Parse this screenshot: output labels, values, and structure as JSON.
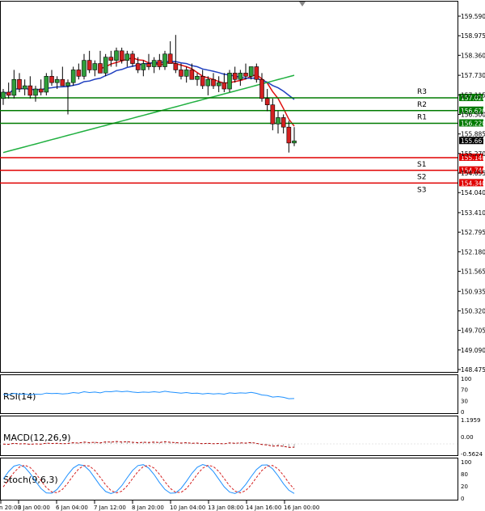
{
  "chart_data": {
    "type": "candlestick",
    "title": "",
    "price_axis": {
      "ticks": [
        "159.590",
        "158.975",
        "158.360",
        "157.730",
        "157.115",
        "156.500",
        "155.885",
        "155.270",
        "154.655",
        "154.040",
        "153.410",
        "152.795",
        "152.180",
        "151.565",
        "150.935",
        "150.320",
        "149.705",
        "149.090",
        "148.475"
      ],
      "range": [
        148.475,
        159.9
      ]
    },
    "time_axis": {
      "ticks": [
        "2 Jan 20:00",
        "3 Jan 00:00",
        "6 Jan 04:00",
        "7 Jan 12:00",
        "8 Jan 20:00",
        "10 Jan 04:00",
        "13 Jan 08:00",
        "14 Jan 16:00",
        "16 Jan 00:00"
      ]
    },
    "current_price": "155.667",
    "levels": [
      {
        "label": "R3",
        "value": 157.02,
        "value_text": "157.020",
        "color": "#007a00"
      },
      {
        "label": "R2",
        "value": 156.62,
        "value_text": "156.620",
        "color": "#007a00"
      },
      {
        "label": "R1",
        "value": 156.22,
        "value_text": "156.220",
        "color": "#007a00"
      },
      {
        "label": "S1",
        "value": 155.14,
        "value_text": "155.140",
        "color": "#e00000"
      },
      {
        "label": "S2",
        "value": 154.74,
        "value_text": "154.740",
        "color": "#e00000"
      },
      {
        "label": "S3",
        "value": 154.34,
        "value_text": "154.340",
        "color": "#e00000"
      }
    ],
    "candles": [
      [
        157.0,
        157.3,
        156.8,
        157.2
      ],
      [
        157.2,
        157.5,
        157.0,
        157.1
      ],
      [
        157.1,
        157.9,
        157.0,
        157.6
      ],
      [
        157.6,
        157.8,
        157.2,
        157.3
      ],
      [
        157.3,
        157.6,
        157.1,
        157.4
      ],
      [
        157.4,
        157.7,
        157.0,
        157.1
      ],
      [
        157.1,
        157.4,
        156.9,
        157.3
      ],
      [
        157.3,
        157.6,
        157.1,
        157.2
      ],
      [
        157.2,
        157.8,
        157.1,
        157.7
      ],
      [
        157.7,
        157.9,
        157.4,
        157.5
      ],
      [
        157.5,
        157.7,
        157.3,
        157.6
      ],
      [
        157.6,
        158.0,
        157.5,
        157.4
      ],
      [
        157.4,
        157.6,
        156.5,
        157.5
      ],
      [
        157.5,
        158.0,
        157.4,
        157.9
      ],
      [
        157.9,
        158.1,
        157.6,
        157.7
      ],
      [
        157.7,
        158.4,
        157.6,
        158.2
      ],
      [
        158.2,
        158.5,
        157.8,
        157.9
      ],
      [
        157.9,
        158.2,
        157.7,
        158.1
      ],
      [
        158.1,
        158.5,
        157.8,
        157.8
      ],
      [
        157.8,
        158.4,
        157.7,
        158.3
      ],
      [
        158.3,
        158.5,
        158.0,
        158.2
      ],
      [
        158.2,
        158.6,
        158.0,
        158.5
      ],
      [
        158.5,
        158.6,
        158.1,
        158.2
      ],
      [
        158.2,
        158.5,
        158.0,
        158.4
      ],
      [
        158.4,
        158.5,
        158.0,
        158.1
      ],
      [
        158.1,
        158.3,
        157.8,
        157.9
      ],
      [
        157.9,
        158.2,
        157.7,
        158.1
      ],
      [
        158.1,
        158.4,
        157.9,
        158.0
      ],
      [
        158.0,
        158.3,
        157.8,
        158.2
      ],
      [
        158.2,
        158.4,
        157.9,
        158.0
      ],
      [
        158.0,
        158.5,
        157.9,
        158.4
      ],
      [
        158.4,
        158.8,
        158.2,
        158.1
      ],
      [
        158.1,
        159.0,
        157.8,
        157.9
      ],
      [
        157.9,
        158.1,
        157.6,
        157.7
      ],
      [
        157.7,
        158.0,
        157.5,
        157.9
      ],
      [
        157.9,
        158.1,
        157.6,
        157.6
      ],
      [
        157.6,
        157.8,
        157.4,
        157.7
      ],
      [
        157.7,
        157.9,
        157.3,
        157.4
      ],
      [
        157.4,
        157.7,
        157.1,
        157.6
      ],
      [
        157.6,
        157.8,
        157.3,
        157.4
      ],
      [
        157.4,
        157.7,
        157.2,
        157.5
      ],
      [
        157.5,
        157.8,
        157.2,
        157.3
      ],
      [
        157.3,
        157.9,
        157.2,
        157.8
      ],
      [
        157.8,
        158.0,
        157.5,
        157.6
      ],
      [
        157.6,
        157.9,
        157.4,
        157.8
      ],
      [
        157.8,
        158.1,
        157.6,
        157.7
      ],
      [
        157.7,
        158.0,
        157.6,
        158.0
      ],
      [
        158.0,
        158.1,
        157.5,
        157.6
      ],
      [
        157.6,
        157.8,
        156.9,
        157.0
      ],
      [
        157.0,
        157.3,
        156.6,
        156.8
      ],
      [
        156.8,
        157.0,
        156.0,
        156.2
      ],
      [
        156.2,
        156.6,
        155.9,
        156.4
      ],
      [
        156.4,
        156.5,
        155.9,
        156.1
      ],
      [
        156.1,
        156.3,
        155.3,
        155.6
      ],
      [
        155.6,
        156.1,
        155.5,
        155.667
      ]
    ],
    "ma_series": [
      {
        "color": "#e01010"
      },
      {
        "color": "#2040c0"
      },
      {
        "color": "#20b040"
      }
    ],
    "indicators": [
      {
        "name": "RSI(14)",
        "ticks": [
          "100",
          "70",
          "30",
          "0"
        ],
        "color": "#1e90ff"
      },
      {
        "name": "MACD(12,26,9)",
        "ticks": [
          "1.1959",
          "0.00",
          "-0.5624"
        ],
        "color": "#b00000"
      },
      {
        "name": "Stoch(9,6,3)",
        "ticks": [
          "100",
          "80",
          "20",
          "0"
        ],
        "color": "#1e90ff"
      }
    ]
  }
}
